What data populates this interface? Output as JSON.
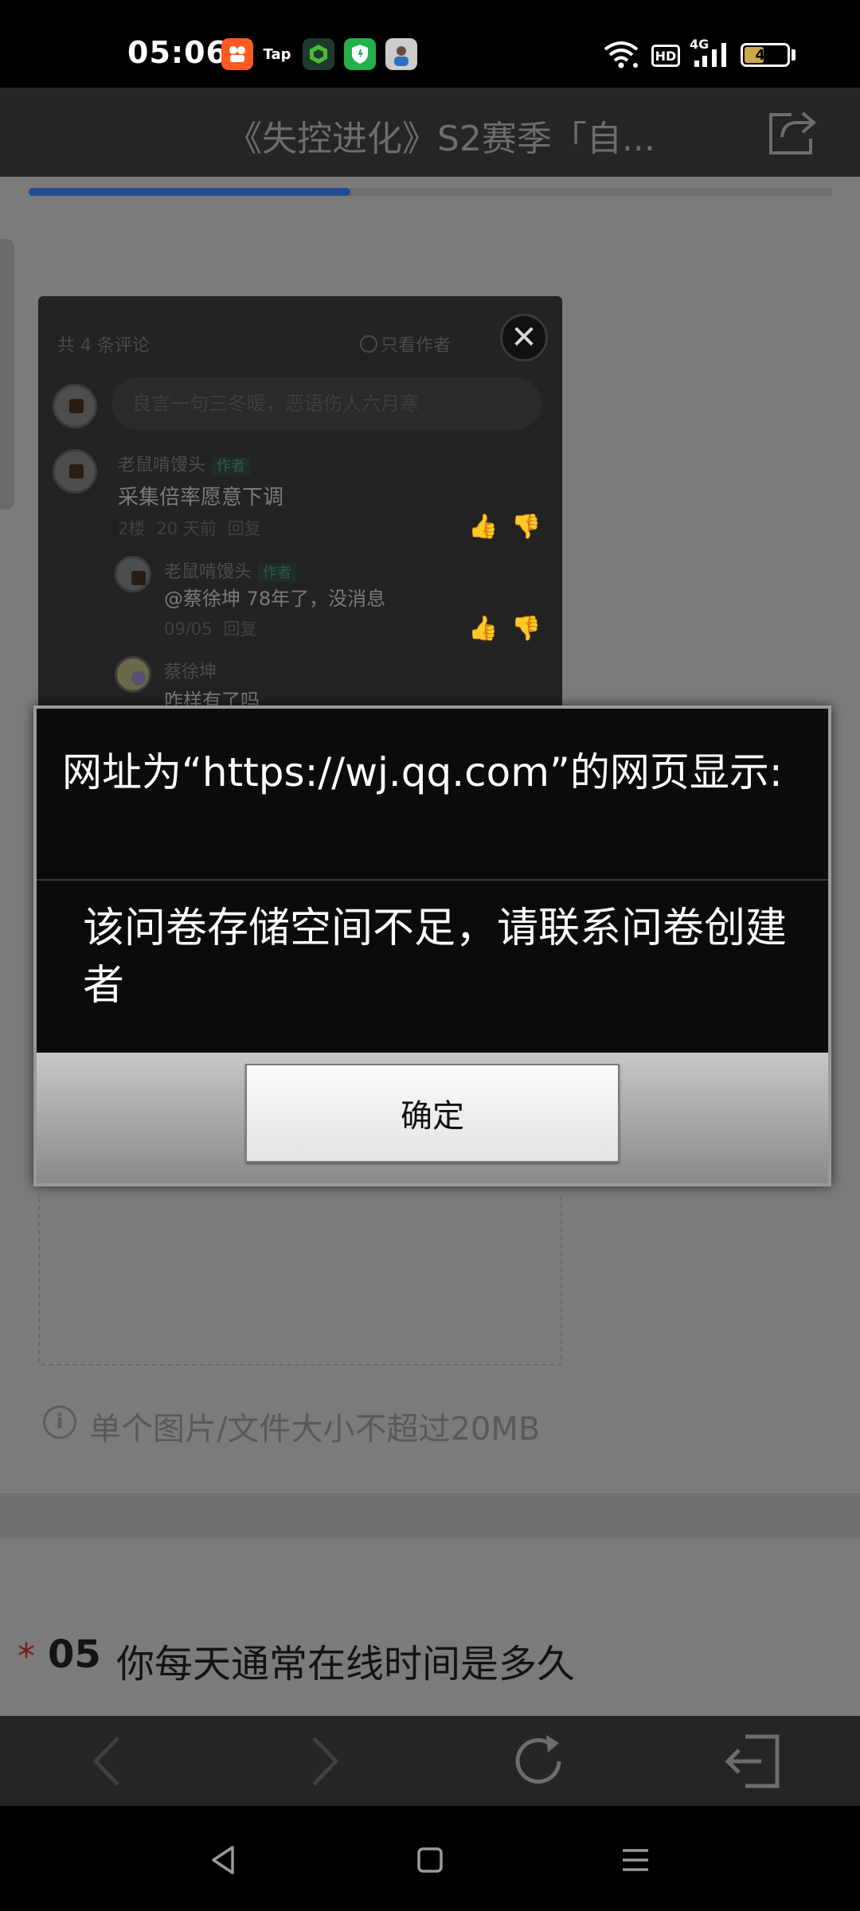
{
  "status_bar": {
    "time": "05:06",
    "app_icons": [
      {
        "name": "kuaishou-icon",
        "label": "",
        "color": "#ff5a1f"
      },
      {
        "name": "taptap-icon",
        "label": "Tap",
        "color": "#000000"
      },
      {
        "name": "game-shield-icon",
        "label": "",
        "color": "#1f3a2a"
      },
      {
        "name": "security-shield-icon",
        "label": "",
        "color": "#22b14c"
      },
      {
        "name": "app-avatar-icon",
        "label": "",
        "color": "#cccccc"
      }
    ],
    "hd_label": "HD",
    "network_label": "4G",
    "battery_level": "46",
    "battery_fraction": 0.46
  },
  "browser": {
    "page_title": "《失控进化》S2赛季「自...",
    "progress_fraction": 0.4
  },
  "comments": {
    "count_label": "共 4 条评论",
    "only_author_label": "只看作者",
    "input_placeholder": "良言一句三冬暖，恶语伤人六月寒",
    "author_tag": "作者",
    "items": [
      {
        "name": "老鼠啃馒头",
        "author": true,
        "text": "采集倍率愿意下调",
        "meta": [
          "2楼",
          "20 天前",
          "回复"
        ]
      },
      {
        "name": "老鼠啃馒头",
        "author": true,
        "text": "@蔡徐坤  78年了，没消息",
        "meta": [
          "09/05",
          "回复"
        ]
      },
      {
        "name": "蔡徐坤",
        "author": false,
        "text": "咋样有了吗",
        "meta": []
      }
    ]
  },
  "form": {
    "upload_hint": "单个图片/文件大小不超过20MB",
    "question_required_mark": "*",
    "question_number": "05",
    "question_text": "你每天通常在线时间是多久"
  },
  "dialog": {
    "title": "网址为“https://wj.qq.com”的网页显示:",
    "message": "该问卷存储空间不足，请联系问卷创建者",
    "ok_label": "确定"
  }
}
